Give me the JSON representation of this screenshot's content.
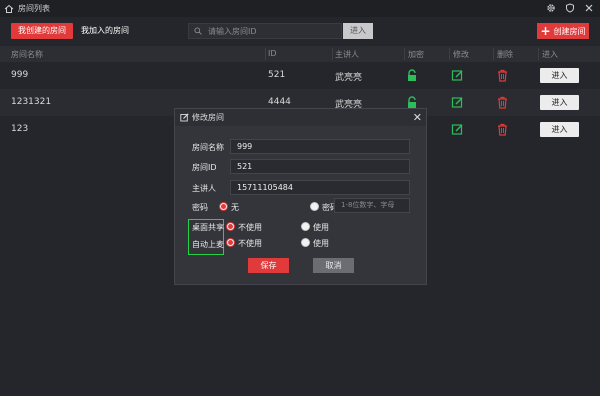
{
  "window": {
    "title": "房间列表"
  },
  "toolbar": {
    "tab_created": "我创建的房间",
    "tab_joined": "我加入的房间",
    "search_placeholder": "请输入房间ID",
    "enter_label": "进入",
    "create_label": "创建房间"
  },
  "table": {
    "headers": {
      "name": "房间名称",
      "id": "ID",
      "host": "主讲人",
      "lock": "加密",
      "edit": "修改",
      "delete": "删除",
      "enter": "进入"
    },
    "rows": [
      {
        "name": "999",
        "id": "521",
        "host": "武亮亮",
        "enter": "进入"
      },
      {
        "name": "1231321",
        "id": "4444",
        "host": "武亮亮",
        "enter": "进入"
      },
      {
        "name": "123",
        "id": "",
        "host": "",
        "enter": "进入"
      }
    ]
  },
  "dialog": {
    "title": "修改房间",
    "name_label": "房间名称",
    "name_value": "999",
    "id_label": "房间ID",
    "id_value": "521",
    "host_label": "主讲人",
    "host_value": "15711105484",
    "password_label": "密码",
    "password_none": "无",
    "password_set": "密码",
    "password_placeholder": "1-8位数字、字母",
    "desktop_share_label": "桌面共享",
    "auto_mic_label": "自动上麦",
    "not_use": "不使用",
    "use": "使用",
    "save_label": "保存",
    "cancel_label": "取消"
  },
  "colors": {
    "accent": "#e03a3a",
    "lock_green": "#2dbd5a",
    "highlight_box": "#24d24a"
  }
}
